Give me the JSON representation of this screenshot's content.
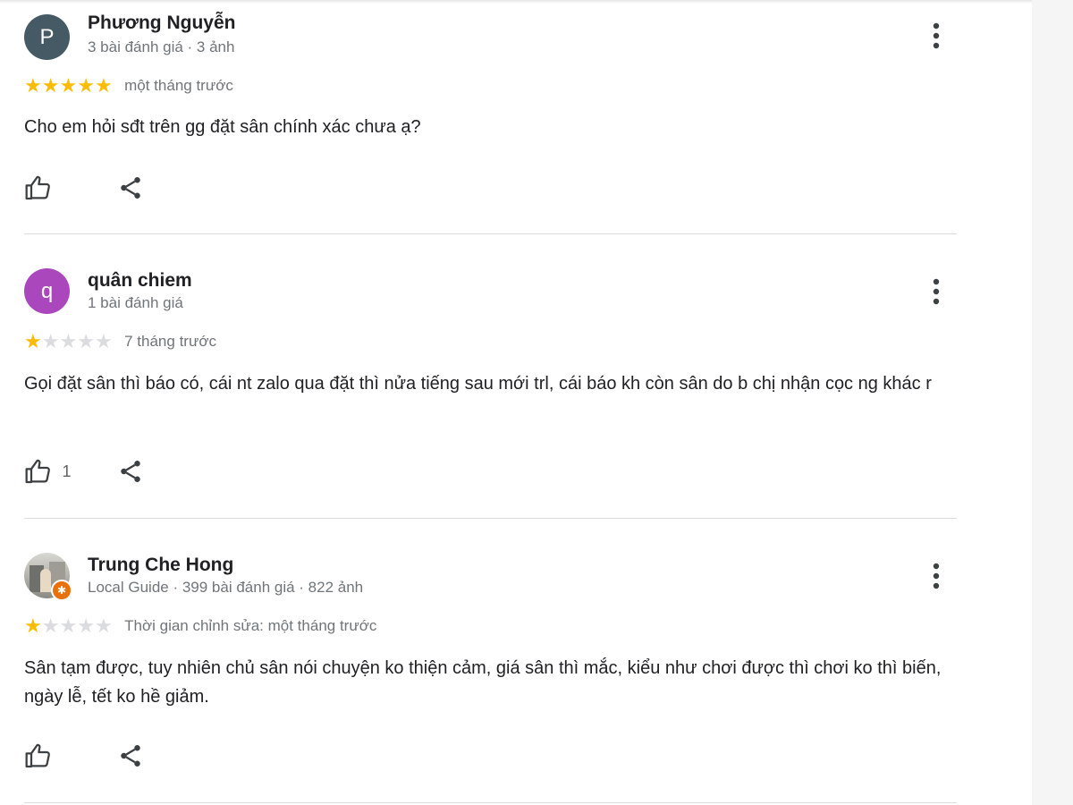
{
  "reviews": [
    {
      "avatar_letter": "P",
      "avatar_color": "#455a64",
      "name": "Phương Nguyễn",
      "meta": "3 bài đánh giá · 3 ảnh",
      "rating": 5,
      "date": "một tháng trước",
      "text": "Cho em hỏi sđt trên gg đặt sân chính xác chưa ạ?",
      "likes": ""
    },
    {
      "avatar_letter": "q",
      "avatar_color": "#ab47bc",
      "name": "quân chiem",
      "meta": "1 bài đánh giá",
      "rating": 1,
      "date": "7 tháng trước",
      "text": "Gọi đặt sân thì báo có, cái nt zalo qua đặt thì nửa tiếng sau mới trl, cái báo kh còn sân do b chị nhận cọc ng khác r",
      "likes": "1"
    },
    {
      "avatar_letter": "",
      "avatar_color": "#9e9c94",
      "name": "Trung Che Hong",
      "meta": "Local Guide · 399 bài đánh giá · 822 ảnh",
      "rating": 1,
      "date": "Thời gian chỉnh sửa: một tháng trước",
      "text": "Sân tạm được, tuy nhiên chủ sân nói chuyện ko thiện cảm, giá sân thì mắc, kiểu như chơi được thì chơi ko thì biến, ngày lễ, tết ko hề giảm.",
      "likes": ""
    }
  ],
  "icons": {
    "more": "more-vert-icon",
    "like": "thumb-up-icon",
    "share": "share-icon",
    "star": "star-icon",
    "local_guide": "local-guide-badge-icon"
  },
  "colors": {
    "star_on": "#fbbc04",
    "star_off": "#dadce0",
    "badge": "#e8710a"
  }
}
